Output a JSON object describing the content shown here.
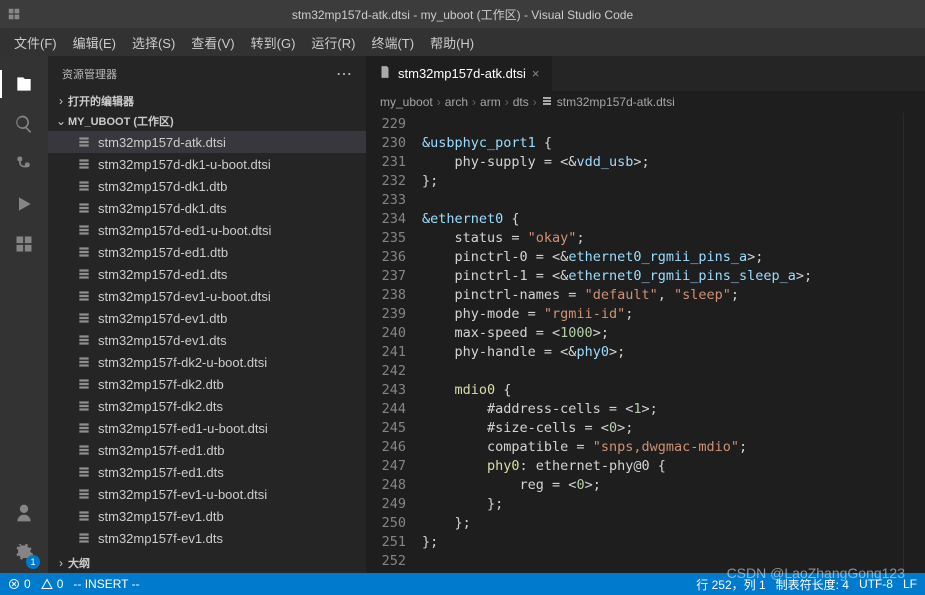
{
  "title": "stm32mp157d-atk.dtsi - my_uboot (工作区) - Visual Studio Code",
  "menu": [
    "文件(F)",
    "编辑(E)",
    "选择(S)",
    "查看(V)",
    "转到(G)",
    "运行(R)",
    "终端(T)",
    "帮助(H)"
  ],
  "sidebar": {
    "title": "资源管理器",
    "open_editors": "打开的编辑器",
    "workspace": "MY_UBOOT (工作区)",
    "outline": "大纲",
    "files": [
      "stm32mp157d-atk.dtsi",
      "stm32mp157d-dk1-u-boot.dtsi",
      "stm32mp157d-dk1.dtb",
      "stm32mp157d-dk1.dts",
      "stm32mp157d-ed1-u-boot.dtsi",
      "stm32mp157d-ed1.dtb",
      "stm32mp157d-ed1.dts",
      "stm32mp157d-ev1-u-boot.dtsi",
      "stm32mp157d-ev1.dtb",
      "stm32mp157d-ev1.dts",
      "stm32mp157f-dk2-u-boot.dtsi",
      "stm32mp157f-dk2.dtb",
      "stm32mp157f-dk2.dts",
      "stm32mp157f-ed1-u-boot.dtsi",
      "stm32mp157f-ed1.dtb",
      "stm32mp157f-ed1.dts",
      "stm32mp157f-ev1-u-boot.dtsi",
      "stm32mp157f-ev1.dtb",
      "stm32mp157f-ev1.dts"
    ]
  },
  "tab": {
    "name": "stm32mp157d-atk.dtsi"
  },
  "breadcrumb": [
    "my_uboot",
    "arch",
    "arm",
    "dts",
    "stm32mp157d-atk.dtsi"
  ],
  "code": {
    "start": 229,
    "lines": [
      "",
      "&usbphyc_port1 {",
      "    phy-supply = <&vdd_usb>;",
      "};",
      "",
      "&ethernet0 {",
      "    status = \"okay\";",
      "    pinctrl-0 = <&ethernet0_rgmii_pins_a>;",
      "    pinctrl-1 = <&ethernet0_rgmii_pins_sleep_a>;",
      "    pinctrl-names = \"default\", \"sleep\";",
      "    phy-mode = \"rgmii-id\";",
      "    max-speed = <1000>;",
      "    phy-handle = <&phy0>;",
      "",
      "    mdio0 {",
      "        #address-cells = <1>;",
      "        #size-cells = <0>;",
      "        compatible = \"snps,dwgmac-mdio\";",
      "        phy0: ethernet-phy@0 {",
      "            reg = <0>;",
      "        };",
      "    };",
      "};",
      ""
    ]
  },
  "status": {
    "errors": "0",
    "warnings": "0",
    "insert": "-- INSERT --",
    "position": "行 252，列 1",
    "tabsize": "制表符长度: 4",
    "encoding": "UTF-8",
    "lf": "LF"
  },
  "settings_badge": "1",
  "watermark": "CSDN @LaoZhangGong123"
}
